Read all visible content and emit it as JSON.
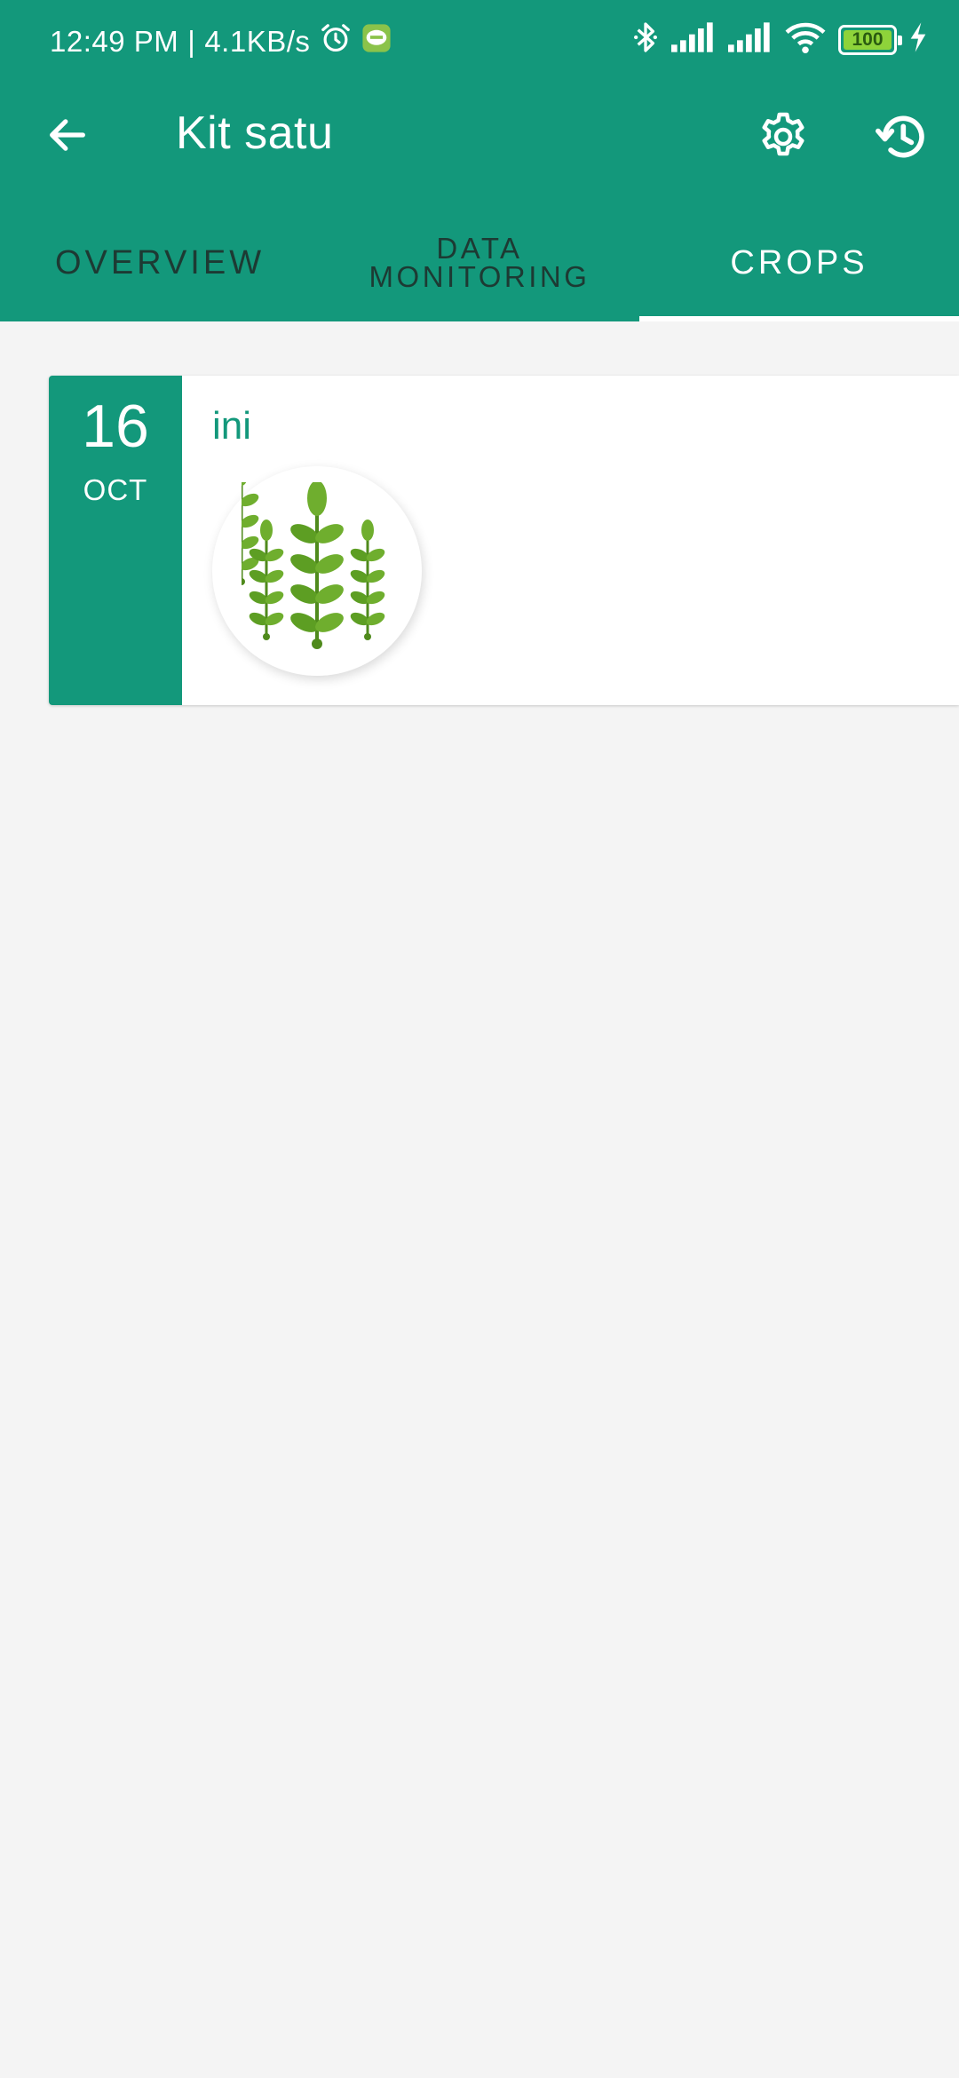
{
  "status_bar": {
    "time": "12:49 PM",
    "separator": "|",
    "network_speed": "4.1KB/s",
    "battery_level": "100",
    "icons": [
      "alarm-icon",
      "line-app-icon",
      "bluetooth-icon",
      "signal-icon",
      "signal-icon",
      "wifi-icon",
      "battery-icon",
      "charging-icon"
    ]
  },
  "toolbar": {
    "title": "Kit satu",
    "back_icon": "arrow-back-icon",
    "settings_icon": "gear-icon",
    "history_icon": "history-icon"
  },
  "tabs": [
    {
      "label": "OVERVIEW",
      "active": false
    },
    {
      "label": "DATA\nMONITORING",
      "active": false
    },
    {
      "label": "CROPS",
      "active": true
    }
  ],
  "crops": [
    {
      "day": "16",
      "month": "OCT",
      "name": "ini",
      "image_icon": "plant-sprouts-icon"
    }
  ],
  "colors": {
    "primary": "#13987b",
    "background": "#f4f4f4",
    "card": "#ffffff",
    "tab_inactive_text": "#1d3a33",
    "plant_green": "#5d9e23"
  }
}
